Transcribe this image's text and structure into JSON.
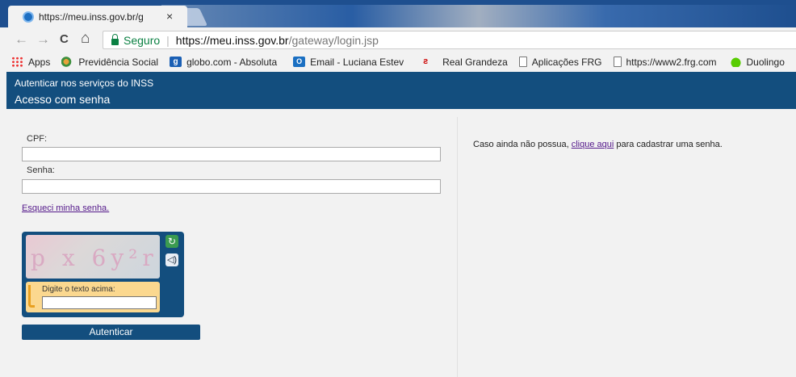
{
  "browser": {
    "tab_title": "https://meu.inss.gov.br/g",
    "tab_close": "×",
    "back_icon": "←",
    "forward_icon": "→",
    "reload_icon": "C",
    "home_icon": "⌂",
    "secure_label": "Seguro",
    "url_host": "https://meu.inss.gov.br",
    "url_path": "/gateway/login.jsp",
    "bookmarks": [
      {
        "label": "Apps",
        "icon": "apps-icon"
      },
      {
        "label": "Previdência Social",
        "icon": "previdencia-icon"
      },
      {
        "label": "globo.com - Absoluta",
        "icon": "globo-icon"
      },
      {
        "label": "Email - Luciana Estev",
        "icon": "outlook-icon"
      },
      {
        "label": "Real Grandeza",
        "icon": "real-grandeza-icon"
      },
      {
        "label": "Aplicações FRG",
        "icon": "page-icon"
      },
      {
        "label": "https://www2.frg.com",
        "icon": "page-icon"
      },
      {
        "label": "Duolingo",
        "icon": "duolingo-icon"
      }
    ]
  },
  "header": {
    "subtitle": "Autenticar nos serviços do INSS",
    "title": "Acesso com senha"
  },
  "form": {
    "cpf_label": "CPF:",
    "cpf_value": "",
    "senha_label": "Senha:",
    "senha_value": "",
    "forgot_link": "Esqueci minha senha.",
    "captcha_text": "p x 6y²r",
    "captcha_prompt": "Digite o texto acima:",
    "captcha_value": "",
    "submit_label": "Autenticar"
  },
  "register": {
    "prefix": "Caso ainda não possua, ",
    "link": "clique aqui",
    "suffix": " para cadastrar uma senha."
  },
  "colors": {
    "brand": "#134e7e",
    "secure": "#0b8043",
    "link": "#551a8b"
  }
}
